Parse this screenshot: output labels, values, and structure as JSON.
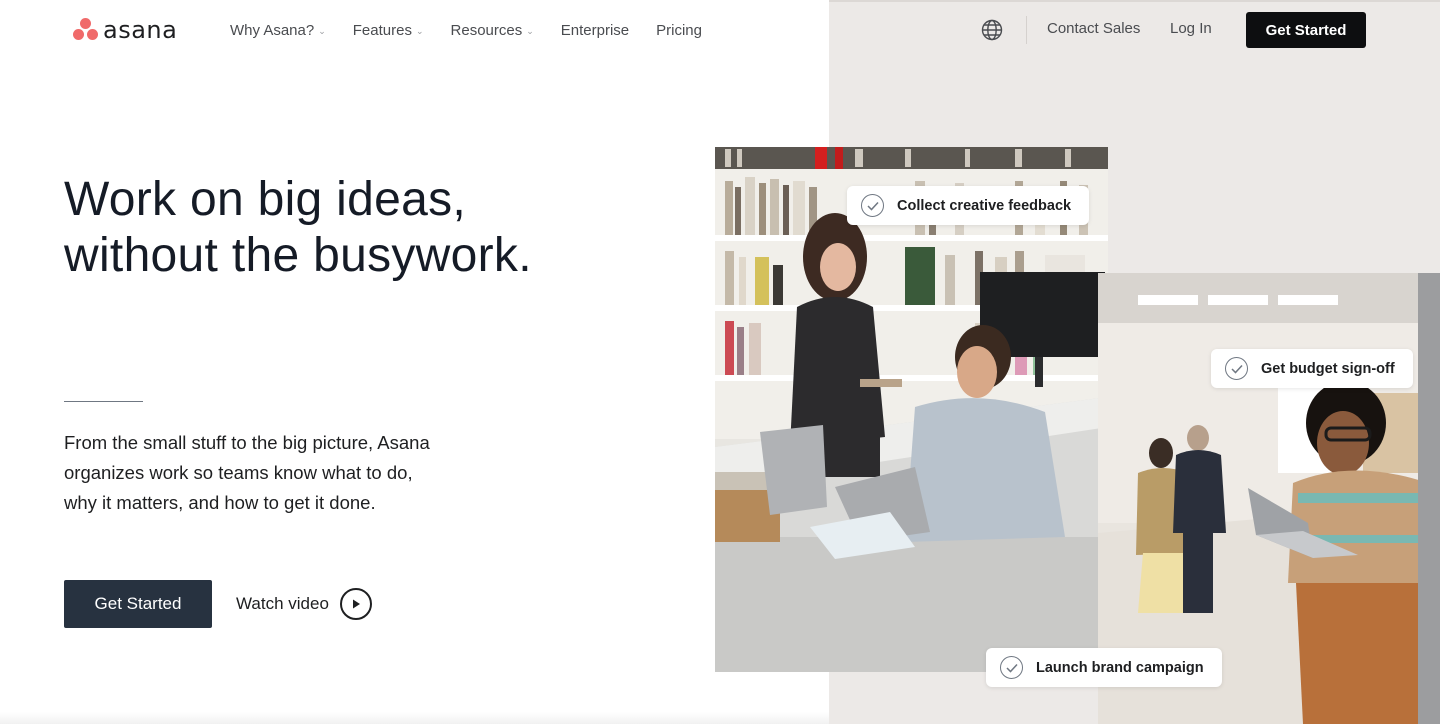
{
  "brand": {
    "name": "asana",
    "logo_color": "#f06a6a"
  },
  "nav": {
    "items": [
      {
        "label": "Why Asana?",
        "dropdown": true
      },
      {
        "label": "Features",
        "dropdown": true
      },
      {
        "label": "Resources",
        "dropdown": true
      },
      {
        "label": "Enterprise",
        "dropdown": false
      },
      {
        "label": "Pricing",
        "dropdown": false
      }
    ],
    "language_icon": "globe-icon",
    "contact_sales": "Contact Sales",
    "login": "Log In",
    "cta": "Get Started"
  },
  "hero": {
    "headline_line1": "Work on big ideas,",
    "headline_line2": "without the busywork.",
    "subcopy_line1": "From the small stuff to the big picture, Asana",
    "subcopy_line2": "organizes work so teams know what to do,",
    "subcopy_line3": "why it matters, and how to get it done.",
    "cta": "Get Started",
    "watch_video": "Watch video"
  },
  "task_pills": [
    {
      "label": "Collect creative feedback"
    },
    {
      "label": "Get budget sign-off"
    },
    {
      "label": "Launch brand campaign"
    }
  ],
  "colors": {
    "dark_cta": "#273240",
    "nav_cta": "#0d0e10",
    "panel_bg": "#ece9e7",
    "text": "#1e1f21"
  }
}
